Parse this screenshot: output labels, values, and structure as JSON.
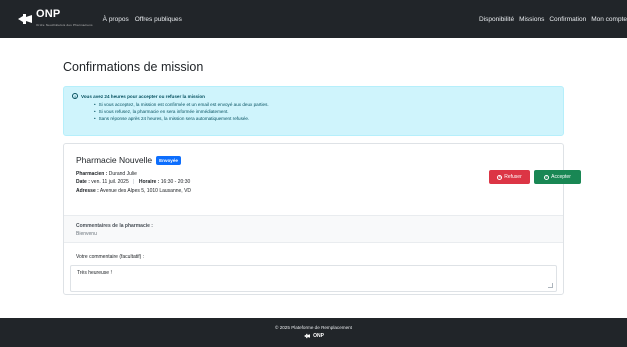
{
  "nav": {
    "brand": "ONP",
    "brand_sub": "Ordre Neuchâtelois des Pharmaciens",
    "left_links": [
      "À propos",
      "Offres publiques"
    ],
    "right_links": [
      "Disponibilité",
      "Missions",
      "Confirmation",
      "Mon compte"
    ]
  },
  "page": {
    "title": "Confirmations de mission"
  },
  "alert": {
    "heading": "Vous avez 24 heures pour accepter ou refuser la mission",
    "items": [
      "Si vous acceptez, la mission est confirmée et un email est envoyé aux deux parties.",
      "Si vous refusez, la pharmacie en sera informée immédiatement.",
      "Sans réponse après 24 heures, la mission sera automatiquement refusée."
    ]
  },
  "mission": {
    "pharmacy": "Pharmacie Nouvelle",
    "status": "Envoyée",
    "pharmacist_label": "Pharmacien :",
    "pharmacist": "Durand Julie",
    "date_label": "Date :",
    "date": "ven. 11 juil. 2025",
    "hours_label": "Horaire :",
    "hours": "16:30 - 20:30",
    "address_label": "Adresse :",
    "address": "Avenue des Alpes 5, 1010 Lausanne, VD",
    "refuse_label": "Refuser",
    "accept_label": "Accepter"
  },
  "comments": {
    "pharmacy_label": "Commentaires de la pharmacie :",
    "pharmacy_value": "Bienvenu",
    "your_label": "Votre commentaire (facultatif) :",
    "your_value": "Très heureuse !"
  },
  "footer": {
    "copyright": "© 2025 Plateforme de Remplacement",
    "logo": "ONP"
  },
  "colors": {
    "navbar": "#212529",
    "alert_bg": "#cff4fc",
    "badge": "#0d6efd",
    "refuse": "#dc3545",
    "accept": "#198754"
  }
}
